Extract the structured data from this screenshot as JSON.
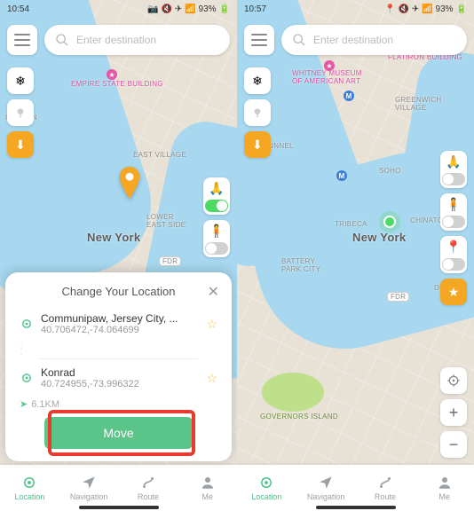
{
  "phone1": {
    "status": {
      "time": "10:54",
      "battery": "93%"
    },
    "search": {
      "placeholder": "Enter destination"
    },
    "map": {
      "city": "New York",
      "labels": {
        "empire": "Empire State Building",
        "eastvillage": "EAST VILLAGE",
        "lowereast": "LOWER\nEAST SIDE",
        "oboken": "OBOKEN",
        "fdr": "FDR"
      }
    },
    "sheet": {
      "title": "Change Your Location",
      "loc1": {
        "name": "Communipaw, Jersey City, ...",
        "coords": "40.706472,-74.064699"
      },
      "loc2": {
        "name": "Konrad",
        "coords": "40.724955,-73.996322"
      },
      "distance": "6.1KM",
      "move": "Move"
    },
    "tabs": {
      "location": "Location",
      "navigation": "Navigation",
      "route": "Route",
      "me": "Me"
    }
  },
  "phone2": {
    "status": {
      "time": "10:57",
      "battery": "93%"
    },
    "search": {
      "placeholder": "Enter destination"
    },
    "map": {
      "city": "New York",
      "labels": {
        "whitney": "Whitney Museum\nof American Art",
        "flatiron": "Flatiron Building",
        "greenwich": "GREENWICH\nVILLAGE",
        "soho": "SOHO",
        "tribeca": "TRIBECA",
        "chinatown": "CHINATOWN",
        "battery": "BATTERY\nPARK CITY",
        "tunnel": "TUNNEL",
        "dumbo": "DUMBO",
        "governors": "Governors Island",
        "fdr": "FDR"
      }
    },
    "tabs": {
      "location": "Location",
      "navigation": "Navigation",
      "route": "Route",
      "me": "Me"
    }
  }
}
